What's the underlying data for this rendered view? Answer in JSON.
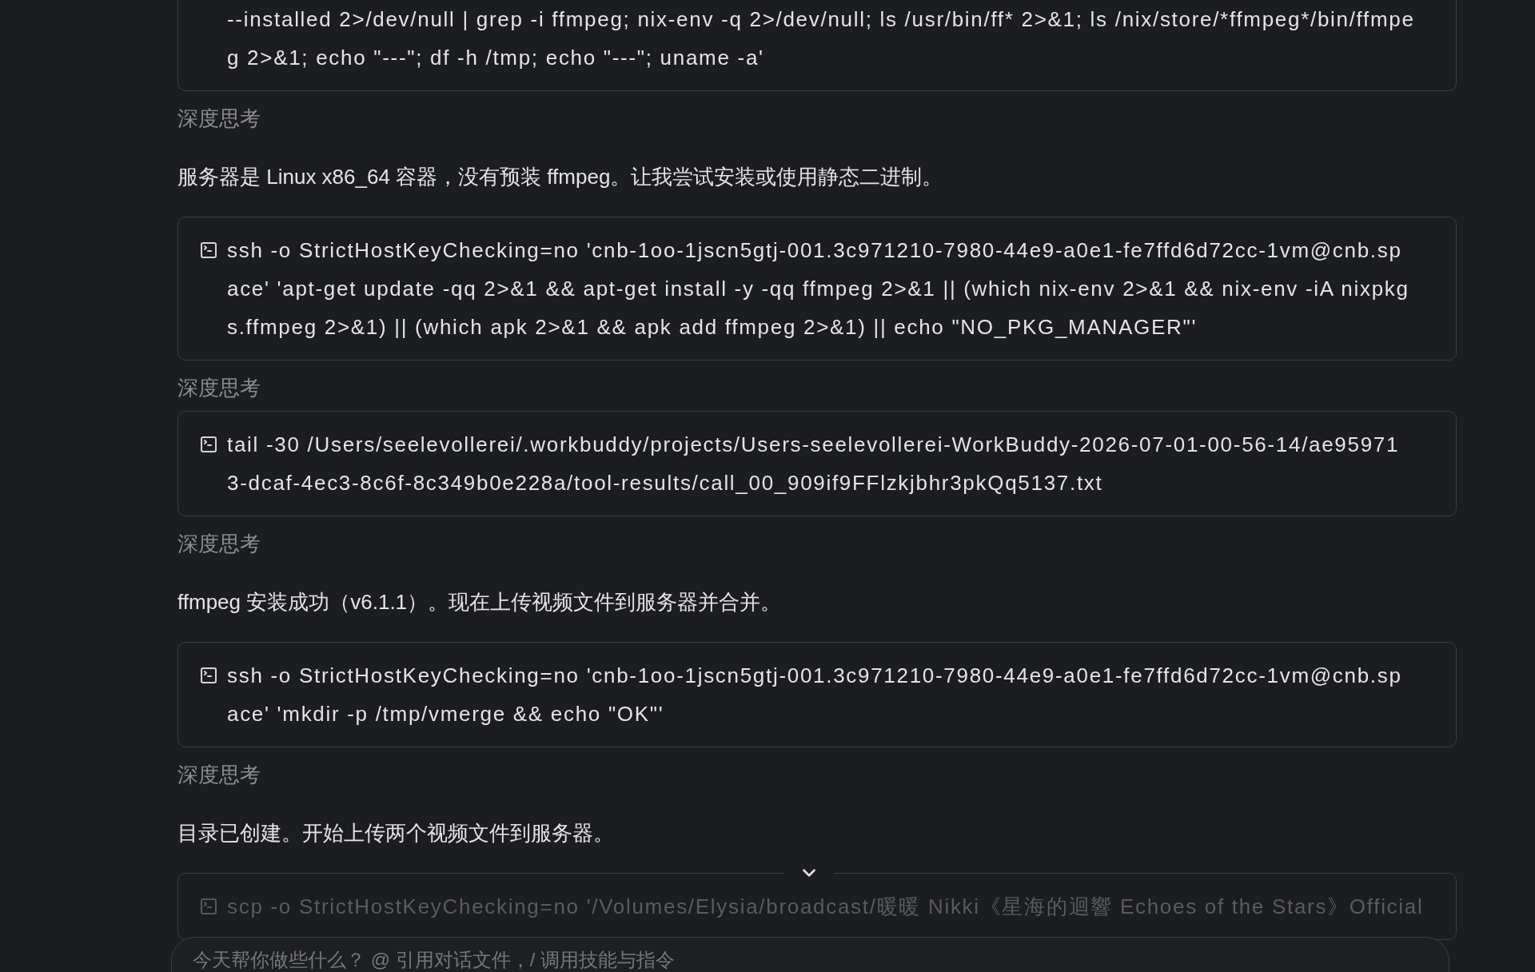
{
  "messages": [
    {
      "kind": "command",
      "faded": false,
      "cut_top": true,
      "lines": [
        "--installed 2>/dev/null | grep -i ffmpeg; nix-env -q 2>/dev/null; ls /usr/bin/ff* 2>&1; ls /nix/store/*ffmpeg*/bin/ffmpe",
        "g 2>&1; echo \"---\"; df -h /tmp; echo \"---\"; uname -a'"
      ]
    },
    {
      "kind": "thinking",
      "label": "深度思考"
    },
    {
      "kind": "text",
      "text": "服务器是 Linux x86_64 容器，没有预装 ffmpeg。让我尝试安装或使用静态二进制。"
    },
    {
      "kind": "command",
      "faded": false,
      "cut_top": false,
      "lines": [
        "ssh -o StrictHostKeyChecking=no 'cnb-1oo-1jscn5gtj-001.3c971210-7980-44e9-a0e1-fe7ffd6d72cc-1vm@cnb.sp",
        "ace' 'apt-get update -qq 2>&1 && apt-get install -y -qq ffmpeg 2>&1 || (which nix-env 2>&1 && nix-env -iA nixpkg",
        "s.ffmpeg 2>&1) || (which apk 2>&1 && apk add ffmpeg 2>&1) || echo \"NO_PKG_MANAGER\"'"
      ]
    },
    {
      "kind": "thinking",
      "label": "深度思考"
    },
    {
      "kind": "command",
      "faded": false,
      "cut_top": false,
      "lines": [
        "tail -30 /Users/seelevollerei/.workbuddy/projects/Users-seelevollerei-WorkBuddy-2026-07-01-00-56-14/ae95971",
        "3-dcaf-4ec3-8c6f-8c349b0e228a/tool-results/call_00_909if9FFlzkjbhr3pkQq5137.txt"
      ]
    },
    {
      "kind": "thinking",
      "label": "深度思考"
    },
    {
      "kind": "text",
      "text": "ffmpeg 安装成功（v6.1.1）。现在上传视频文件到服务器并合并。"
    },
    {
      "kind": "command",
      "faded": false,
      "cut_top": false,
      "lines": [
        "ssh -o StrictHostKeyChecking=no 'cnb-1oo-1jscn5gtj-001.3c971210-7980-44e9-a0e1-fe7ffd6d72cc-1vm@cnb.sp",
        "ace' 'mkdir -p /tmp/vmerge && echo \"OK\"'"
      ]
    },
    {
      "kind": "thinking",
      "label": "深度思考"
    },
    {
      "kind": "text",
      "text": "目录已创建。开始上传两个视频文件到服务器。"
    },
    {
      "kind": "command",
      "faded": true,
      "cut_top": false,
      "lines": [
        "scp -o StrictHostKeyChecking=no '/Volumes/Elysia/broadcast/暖暖 Nikki《星海的迴響 Echoes of the Stars》Official"
      ]
    }
  ],
  "composer": {
    "placeholder": "今天帮你做些什么？ @ 引用对话文件，/ 调用技能与指令"
  }
}
